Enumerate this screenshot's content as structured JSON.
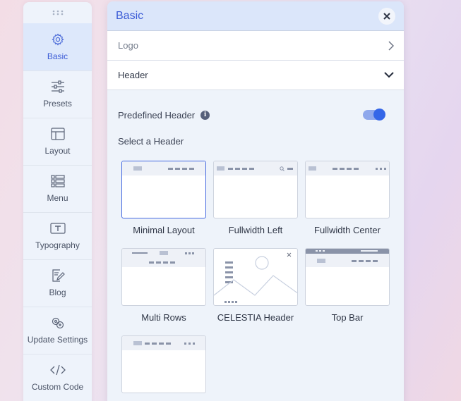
{
  "sidebar": {
    "items": [
      {
        "label": "Basic",
        "icon": "gear-icon",
        "active": true
      },
      {
        "label": "Presets",
        "icon": "sliders-icon"
      },
      {
        "label": "Layout",
        "icon": "layout-icon"
      },
      {
        "label": "Menu",
        "icon": "menu-list-icon"
      },
      {
        "label": "Typography",
        "icon": "typography-icon"
      },
      {
        "label": "Blog",
        "icon": "blog-icon"
      },
      {
        "label": "Update Settings",
        "icon": "update-settings-icon"
      },
      {
        "label": "Custom Code",
        "icon": "code-icon"
      }
    ]
  },
  "panel": {
    "title": "Basic",
    "sections": [
      {
        "label": "Logo",
        "state": "collapsed"
      },
      {
        "label": "Header",
        "state": "expanded"
      }
    ],
    "predefined_header": {
      "label": "Predefined Header",
      "enabled": true
    },
    "select_label": "Select a Header",
    "headers": [
      {
        "label": "Minimal Layout",
        "selected": true
      },
      {
        "label": "Fullwidth Left"
      },
      {
        "label": "Fullwidth Center"
      },
      {
        "label": "Multi Rows"
      },
      {
        "label": "CELESTIA Header"
      },
      {
        "label": "Top Bar"
      },
      {
        "label": ""
      }
    ]
  },
  "colors": {
    "accent": "#3b5bd6",
    "toggle_knob": "#3466e8",
    "toggle_track": "#8fa8ec",
    "thumb_bar": "#c7cfdf"
  }
}
